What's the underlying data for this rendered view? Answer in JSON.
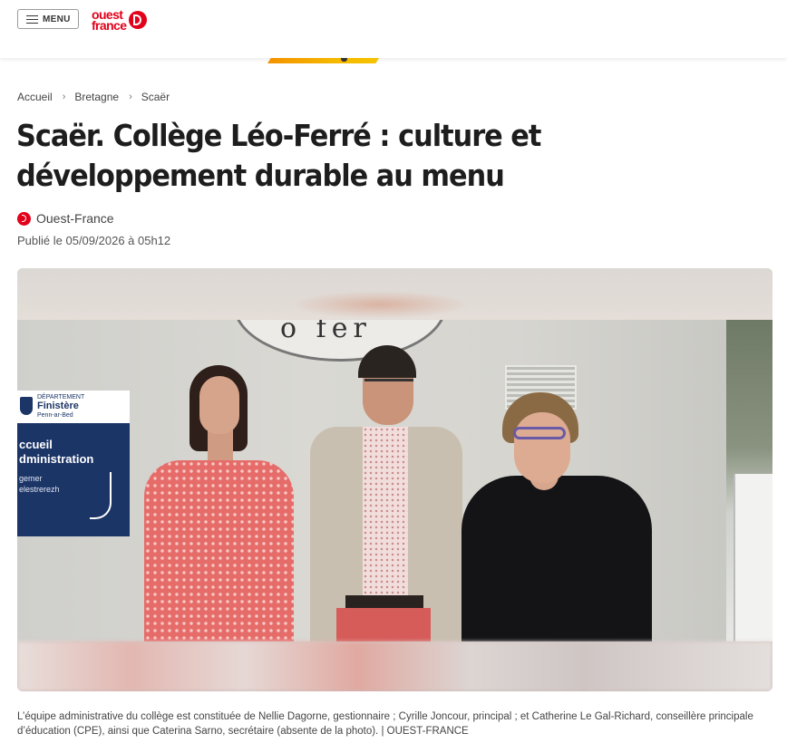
{
  "header": {
    "menu_label": "MENU",
    "logo_line1": "ouest",
    "logo_line2": "france",
    "brand_color": "#e2001a"
  },
  "breadcrumb": [
    "Accueil",
    "Bretagne",
    "Scaër"
  ],
  "article": {
    "title": "Scaër. Collège Léo-Ferré : culture et développement durable au menu",
    "source": "Ouest-France",
    "published": "Publié le 05/09/2026 à 05h12"
  },
  "photo": {
    "sign_text": "o fer",
    "plaque": {
      "dept": "DÉPARTEMENT",
      "name": "Finistère",
      "sub": "Penn-ar-Bed",
      "line1": "ccueil",
      "line2": "dministration",
      "line3": "gemer",
      "line4": "elestrerezh"
    },
    "caption": "L’équipe administrative du collège est constituée de Nellie Dagorne, gestionnaire ; Cyrille Joncour, principal ; et Catherine Le Gal-Richard, conseillère principale d’éducation (CPE), ainsi que Caterina Sarno, secrétaire (absente de la photo). | OUEST-FRANCE"
  },
  "icons": {
    "menu": "hamburger-icon",
    "logo": "ouest-france-logo",
    "source": "ouest-france-icon",
    "breadcrumb_sep": "chevron-right-icon"
  }
}
